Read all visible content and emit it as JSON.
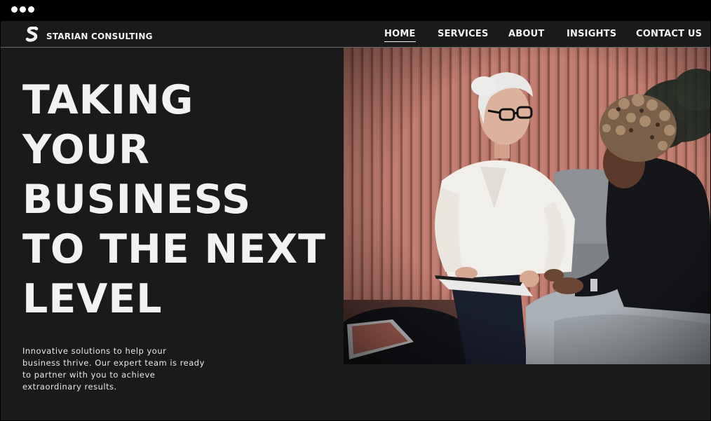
{
  "window": {
    "controls": [
      "dot",
      "dot",
      "dot"
    ]
  },
  "brand": {
    "name": "STARIAN CONSULTING",
    "logo_icon": "s-logo-icon"
  },
  "nav": {
    "items": [
      {
        "label": "HOME",
        "active": true
      },
      {
        "label": "SERVICES",
        "active": false
      },
      {
        "label": "ABOUT",
        "active": false
      },
      {
        "label": "INSIGHTS",
        "active": false
      },
      {
        "label": "CONTACT US",
        "active": false
      }
    ]
  },
  "hero": {
    "headline_lines": [
      "TAKING",
      "YOUR",
      "BUSINESS",
      "TO THE NEXT",
      "LEVEL"
    ],
    "tagline": "Innovative solutions to help your business thrive. Our expert team is ready to partner with you to achieve extraordinary results.",
    "image_subject": "two-women-meeting-photo"
  },
  "colors": {
    "page_background": "#1a1a1a",
    "text": "#f2f2f2",
    "accent_wall": "#c07a6c",
    "titlebar": "#000000"
  }
}
